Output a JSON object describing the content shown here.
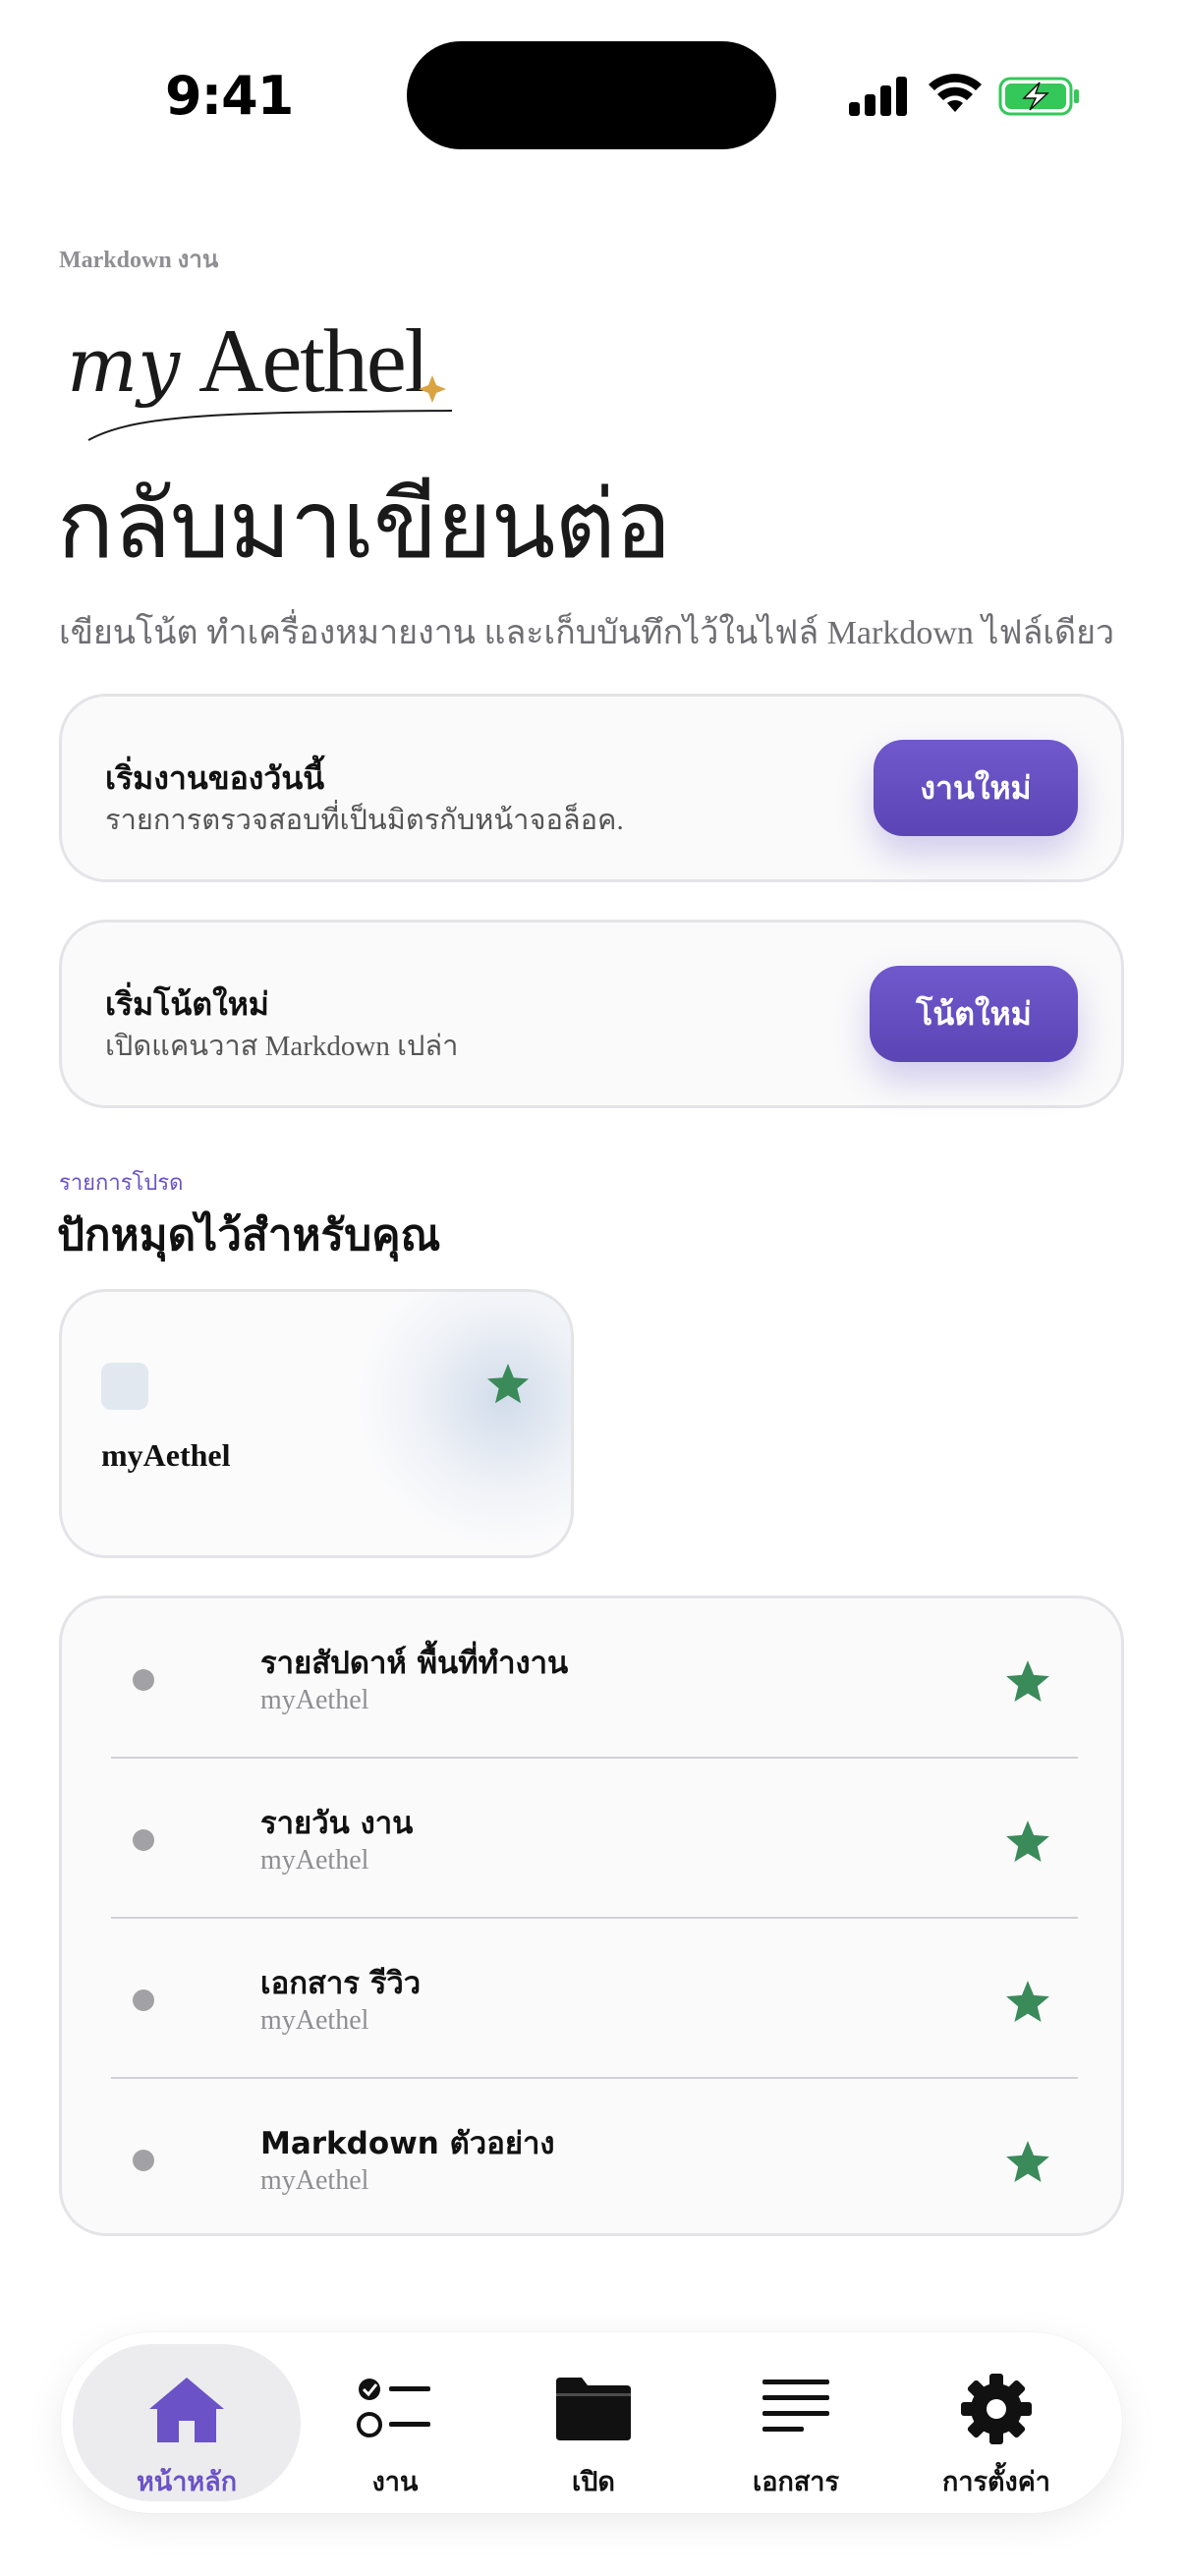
{
  "status_bar": {
    "time": "9:41"
  },
  "header": {
    "app_eyebrow": "Markdown งาน",
    "logo_text": "myAethel",
    "title": "กลับมาเขียนต่อ",
    "subtitle": "เขียนโน้ต ทำเครื่องหมายงาน และเก็บบันทึกไว้ในไฟล์ Markdown ไฟล์เดียว"
  },
  "actions": [
    {
      "title": "เริ่มงานของวันนี้",
      "subtitle": "รายการตรวจสอบที่เป็นมิตรกับหน้าจอล็อค.",
      "button": "งานใหม่"
    },
    {
      "title": "เริ่มโน้ตใหม่",
      "subtitle": "เปิดแคนวาส Markdown เปล่า",
      "button": "โน้ตใหม่"
    }
  ],
  "favorites": {
    "eyebrow": "รายการโปรด",
    "title": "ปักหมุดไว้สำหรับคุณ",
    "pinned": {
      "label": "myAethel",
      "icon": "star-icon"
    }
  },
  "list": [
    {
      "title": "รายสัปดาห์ พื้นที่ทำงาน",
      "subtitle": "myAethel"
    },
    {
      "title": "รายวัน งาน",
      "subtitle": "myAethel"
    },
    {
      "title": "เอกสาร รีวิว",
      "subtitle": "myAethel"
    },
    {
      "title": "Markdown ตัวอย่าง",
      "subtitle": "myAethel"
    }
  ],
  "tabs": [
    {
      "label": "หน้าหลัก",
      "icon": "home-icon",
      "active": true
    },
    {
      "label": "งาน",
      "icon": "checklist-icon",
      "active": false
    },
    {
      "label": "เปิด",
      "icon": "folder-icon",
      "active": false
    },
    {
      "label": "เอกสาร",
      "icon": "text-lines-icon",
      "active": false
    },
    {
      "label": "การตั้งค่า",
      "icon": "gear-icon",
      "active": false
    }
  ],
  "colors": {
    "accent": "#6b52c6",
    "star": "#3a8a5a",
    "battery": "#34c759"
  }
}
